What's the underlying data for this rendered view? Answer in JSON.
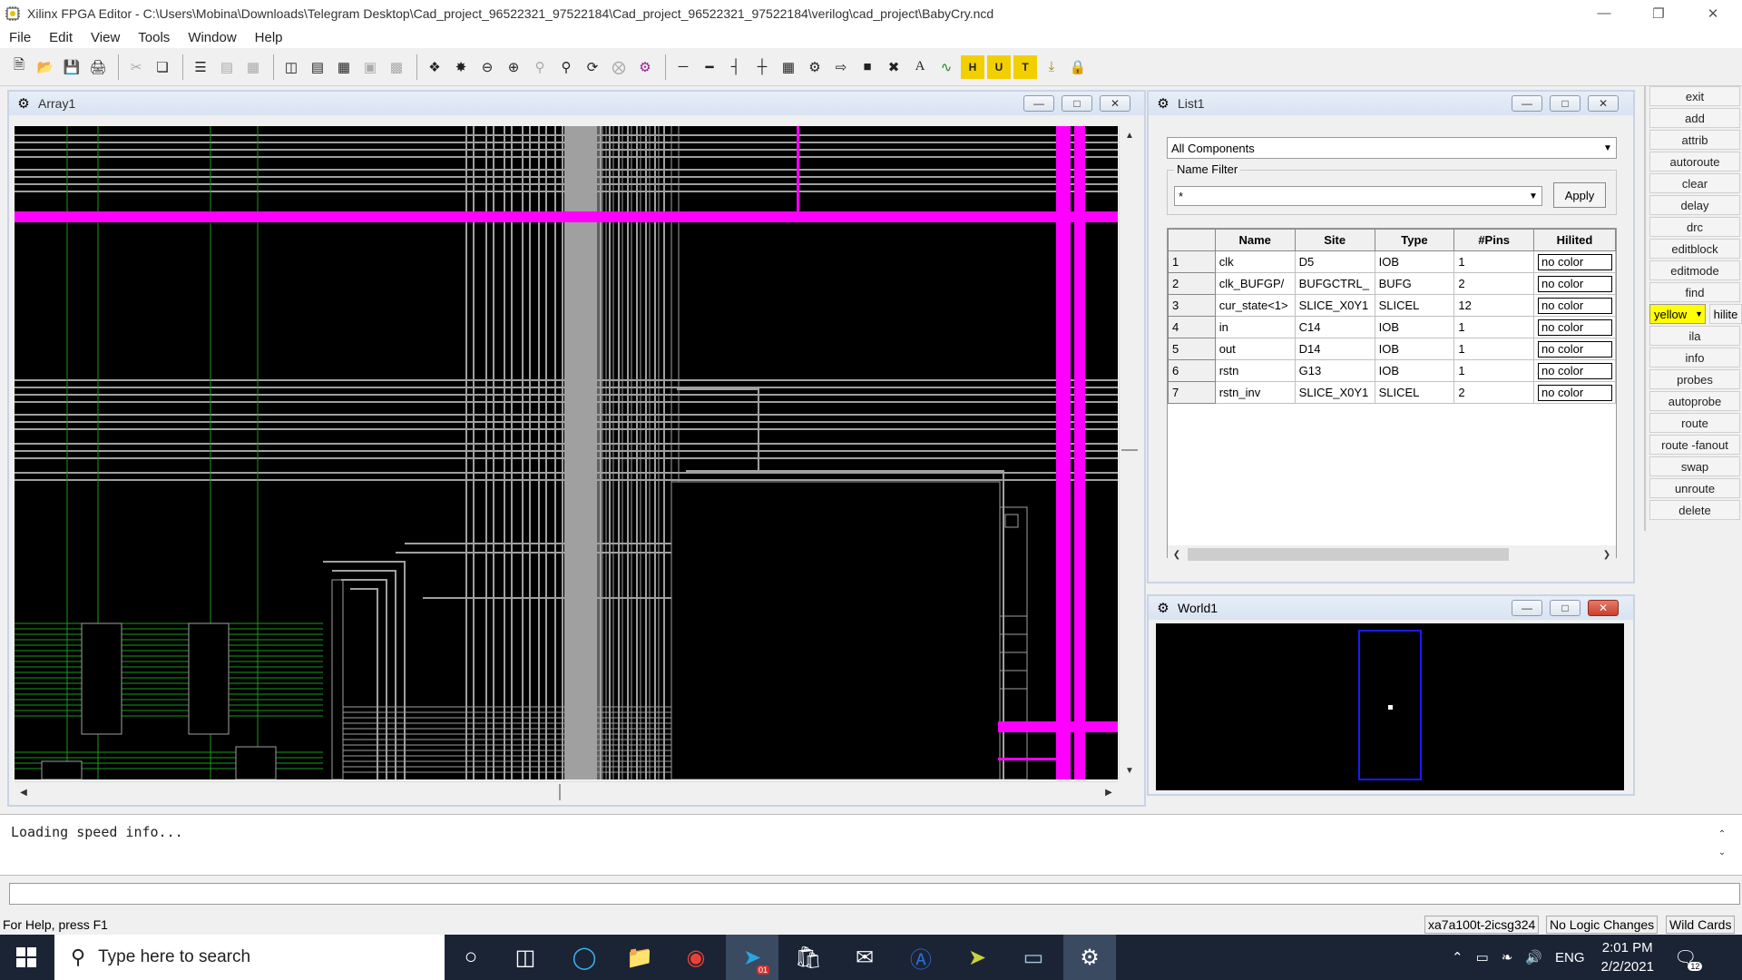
{
  "window": {
    "title": "Xilinx FPGA Editor - C:\\Users\\Mobina\\Downloads\\Telegram Desktop\\Cad_project_96522321_97522184\\Cad_project_96522321_97522184\\verilog\\cad_project\\BabyCry.ncd"
  },
  "menu": [
    "File",
    "Edit",
    "View",
    "Tools",
    "Window",
    "Help"
  ],
  "array_window": {
    "title": "Array1"
  },
  "list_window": {
    "title": "List1",
    "filter_select": "All Components",
    "name_filter_label": "Name Filter",
    "name_filter_value": "*",
    "apply_label": "Apply",
    "columns": [
      "",
      "Name",
      "Site",
      "Type",
      "#Pins",
      "Hilited"
    ],
    "rows": [
      {
        "n": "1",
        "name": "clk",
        "site": "D5",
        "type": "IOB",
        "pins": "1",
        "hilite": "no color"
      },
      {
        "n": "2",
        "name": "clk_BUFGP/",
        "site": "BUFGCTRL_",
        "type": "BUFG",
        "pins": "2",
        "hilite": "no color"
      },
      {
        "n": "3",
        "name": "cur_state<1>",
        "site": "SLICE_X0Y1",
        "type": "SLICEL",
        "pins": "12",
        "hilite": "no color"
      },
      {
        "n": "4",
        "name": "in",
        "site": "C14",
        "type": "IOB",
        "pins": "1",
        "hilite": "no color"
      },
      {
        "n": "5",
        "name": "out",
        "site": "D14",
        "type": "IOB",
        "pins": "1",
        "hilite": "no color"
      },
      {
        "n": "6",
        "name": "rstn",
        "site": "G13",
        "type": "IOB",
        "pins": "1",
        "hilite": "no color"
      },
      {
        "n": "7",
        "name": "rstn_inv",
        "site": "SLICE_X0Y1",
        "type": "SLICEL",
        "pins": "2",
        "hilite": "no color"
      }
    ]
  },
  "world_window": {
    "title": "World1"
  },
  "command_panel": {
    "buttons": [
      "exit",
      "add",
      "attrib",
      "autoroute",
      "clear",
      "delay",
      "drc",
      "editblock",
      "editmode",
      "find"
    ],
    "hilite_color": "yellow",
    "hilite_label": "hilite",
    "buttons2": [
      "ila",
      "info",
      "probes",
      "autoprobe",
      "route",
      "route -fanout",
      "swap",
      "unroute",
      "delete"
    ]
  },
  "output": {
    "message": "Loading speed info..."
  },
  "status": {
    "help": "For Help, press F1",
    "device": "xa7a100t-2icsg324",
    "logic": "No Logic Changes",
    "wildcards": "Wild Cards"
  },
  "taskbar": {
    "search_placeholder": "Type here to search",
    "time": "2:01 PM",
    "date": "2/2/2021",
    "lang": "ENG",
    "notif_count": "12",
    "telegram_badge": "01"
  },
  "colors": {
    "magenta": "#ff00ff",
    "route_gray": "#a0a0a0",
    "green": "#1a9a1a",
    "hilite_yellow": "#ffff00"
  }
}
